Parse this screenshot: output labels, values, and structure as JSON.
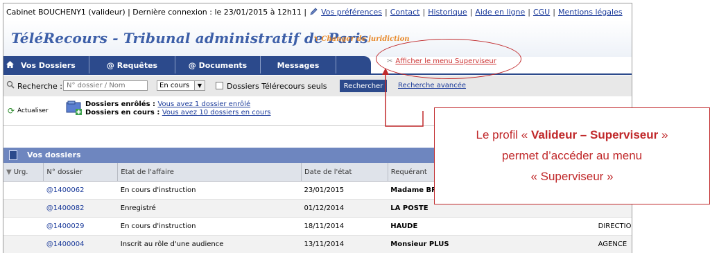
{
  "topbar": {
    "user_info": "Cabinet BOUCHENY1 (valideur) | Dernière connexion : le 23/01/2015 à 12h11 |",
    "links": [
      "Vos préférences",
      "Contact",
      "Historique",
      "Aide en ligne",
      "CGU",
      "Mentions légales"
    ]
  },
  "header": {
    "app_title": "TéléRecours - Tribunal administratif de Paris",
    "change_link": "Changer de juridiction",
    "supervisor_link": "Afficher le menu Superviseur"
  },
  "nav": {
    "tabs": [
      "Vos Dossiers",
      "@ Requêtes",
      "@ Documents",
      "Messages",
      ""
    ]
  },
  "search": {
    "label": "Recherche :",
    "placeholder": "N° dossier / Nom",
    "status_selected": "En cours",
    "checkbox_label": "Dossiers Télérecours seuls",
    "button_label": "Rechercher",
    "advanced_link": "Recherche avancée"
  },
  "info": {
    "refresh_label": "Actualiser",
    "enrolled_label": "Dossiers enrôlés :",
    "enrolled_link": "Vous avez 1 dossier enrôlé",
    "current_label": "Dossiers en cours :",
    "current_link": "Vous avez 10 dossiers en cours"
  },
  "dossiers": {
    "panel_title": "Vos dossiers",
    "columns": [
      "Urg.",
      "N° dossier",
      "Etat de l'affaire",
      "Date de l'état",
      "Requérant",
      ""
    ],
    "rows": [
      {
        "urg": "",
        "num": "@1400062",
        "etat": "En cours d'instruction",
        "date": "23/01/2015",
        "requerant": "Madame BR",
        "extra": ""
      },
      {
        "urg": "",
        "num": "@1400082",
        "etat": "Enregistré",
        "date": "01/12/2014",
        "requerant": "LA POSTE",
        "extra": ""
      },
      {
        "urg": "",
        "num": "@1400029",
        "etat": "En cours d'instruction",
        "date": "18/11/2014",
        "requerant": "HAUDE",
        "extra": "DIRECTIO"
      },
      {
        "urg": "",
        "num": "@1400004",
        "etat": "Inscrit au rôle d'une audience",
        "date": "13/11/2014",
        "requerant": "Monsieur PLUS",
        "extra": "AGENCE"
      }
    ]
  },
  "annotation": {
    "line1_pre": "Le profil « ",
    "line1_bold": "Valideur – Superviseur",
    "line1_post": " »",
    "line2": "permet d’accéder au menu",
    "line3": "« Superviseur »",
    "color": "#c0282a"
  }
}
